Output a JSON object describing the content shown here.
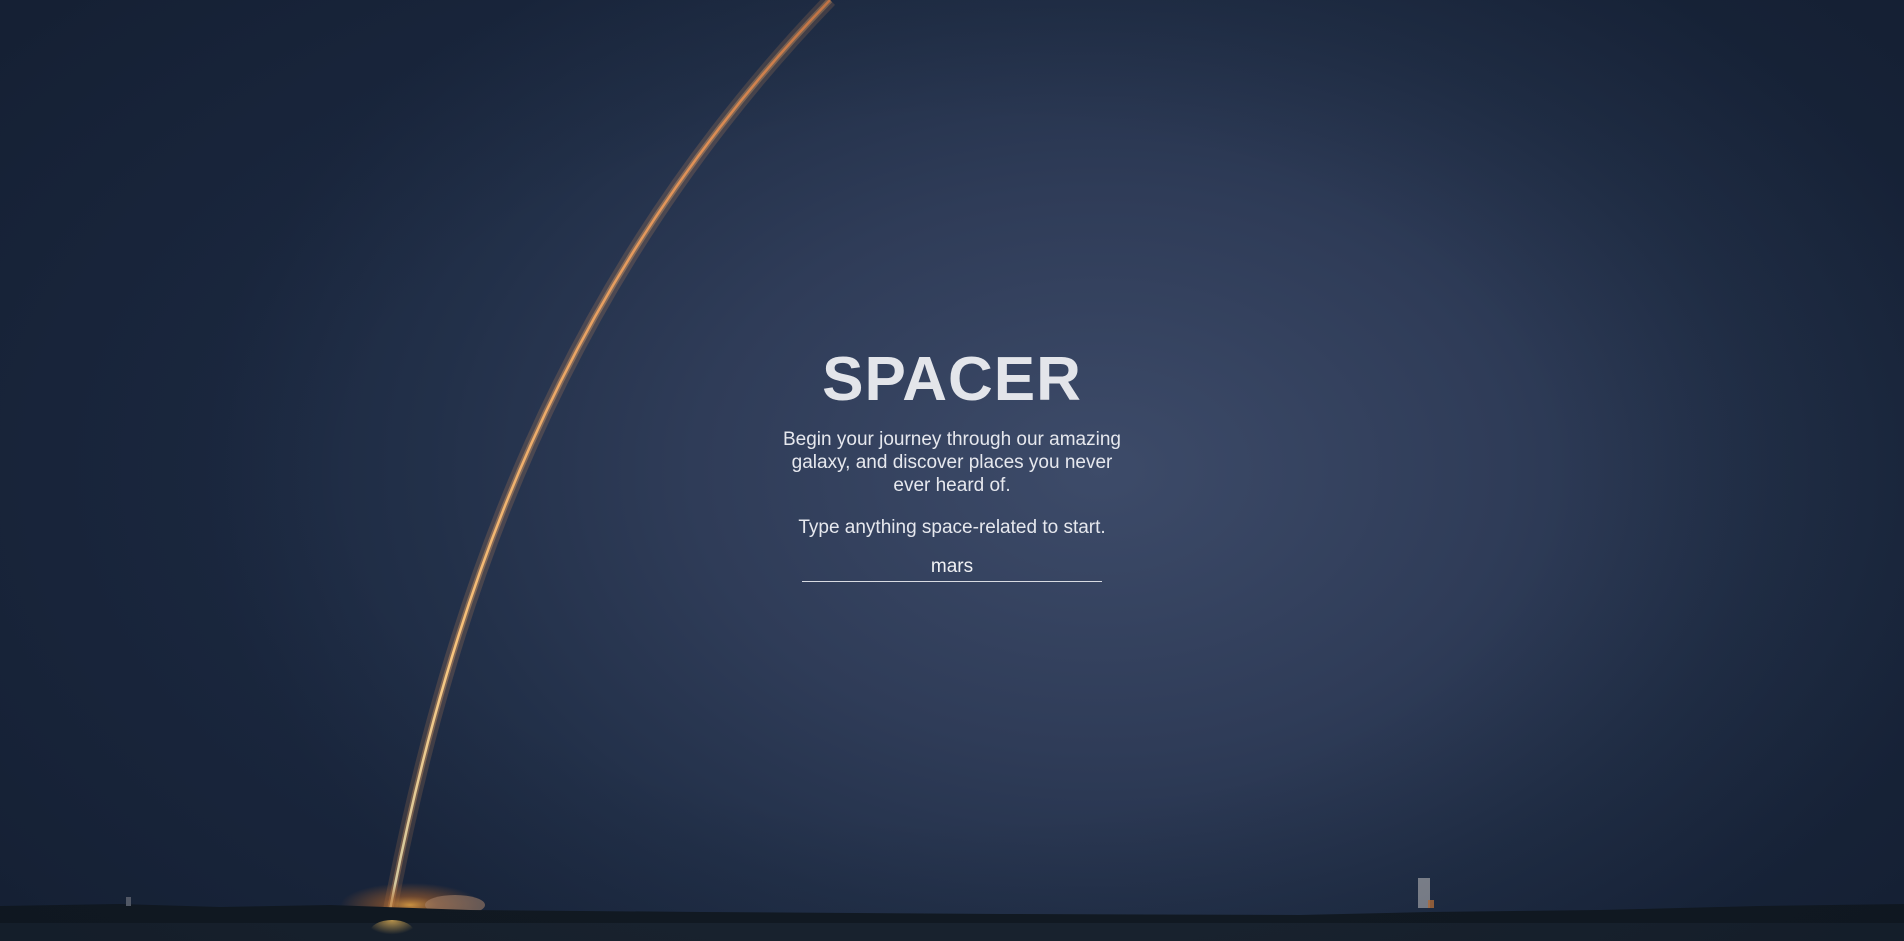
{
  "hero": {
    "title": "SPACER",
    "tagline": "Begin your journey through our amazing galaxy, and discover places you never ever heard of.",
    "prompt": "Type anything space-related to start."
  },
  "search": {
    "value": "mars",
    "placeholder": ""
  },
  "background": {
    "scene": "rocket-launch-night",
    "sky_color": "#2f3c58",
    "trail_color": "#f5b06a"
  }
}
